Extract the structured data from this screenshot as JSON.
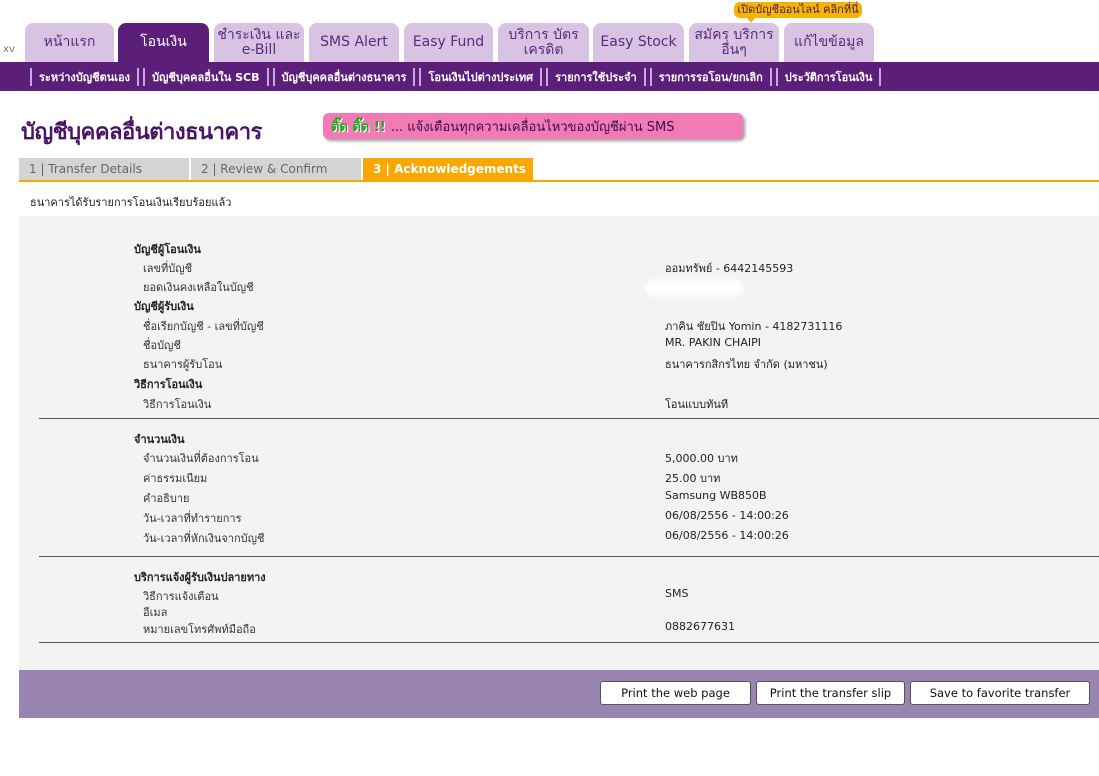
{
  "header": {
    "xv": "xv",
    "promo": "เปิดบัญชีออนไลน์ คลิกที่นี่",
    "tabs": [
      {
        "label": "หน้าแรก"
      },
      {
        "label": "โอนเงิน"
      },
      {
        "label": "ชำระเงิน และ e-Bill"
      },
      {
        "label": "SMS Alert"
      },
      {
        "label": "Easy Fund"
      },
      {
        "label": "บริการ บัตรเครดิต"
      },
      {
        "label": "Easy Stock"
      },
      {
        "label": "สมัคร บริการอื่นๆ"
      },
      {
        "label": "แก้ไขข้อมูล"
      }
    ]
  },
  "subnav": [
    "ระหว่างบัญชีตนเอง",
    "บัญชีบุคคลอื่นใน SCB",
    "บัญชีบุคคลอื่นต่างธนาคาร",
    "โอนเงินไปต่างประเทศ",
    "รายการใช้ประจำ",
    "รายการรอโอน/ยกเลิก",
    "ประวัติการโอนเงิน"
  ],
  "page": {
    "title": "บัญชีบุคคลอื่นต่างธนาคาร",
    "sms_banner_hl": "ติ๊ด ติ๊ด !!",
    "sms_banner": "... แจ้งเตือนทุกความเคลื่อนไหวของบัญชีผ่าน SMS",
    "confirm_msg": "ธนาคารได้รับรายการโอนเงินเรียบร้อยแล้ว"
  },
  "steps": [
    {
      "label": "1 | Transfer Details"
    },
    {
      "label": "2 | Review & Confirm"
    },
    {
      "label": "3 | Acknowledgements"
    }
  ],
  "details": {
    "from_head": "บัญชีผู้โอนเงิน",
    "from_account_lbl": "เลขที่บัญชี",
    "from_account_val": "ออมทรัพย์ - 6442145593",
    "balance_lbl": "ยอดเงินคงเหลือในบัญชี",
    "to_head": "บัญชีผู้รับเงิน",
    "to_alias_lbl": "ชื่อเรียกบัญชี - เลขที่บัญชี",
    "to_alias_val": "ภาคิน ชัยปิน Yomin - 4182731116",
    "to_name_lbl": "ชื่อบัญชี",
    "to_name_val": "MR. PAKIN CHAIPI",
    "to_bank_lbl": "ธนาคารผู้รับโอน",
    "to_bank_val": "ธนาคารกสิกรไทย จำกัด (มหาชน)",
    "method_head": "วิธีการโอนเงิน",
    "method_lbl": "วิธีการโอนเงิน",
    "method_val": "โอนแบบทันที",
    "amount_head": "จำนวนเงิน",
    "amount_lbl": "จำนวนเงินที่ต้องการโอน",
    "amount_val": "5,000.00 บาท",
    "fee_lbl": "ค่าธรรมเนียม",
    "fee_val": "25.00  บาท",
    "desc_lbl": "คำอธิบาย",
    "desc_val": "Samsung WB850B",
    "txn_time_lbl": "วัน-เวลาที่ทำรายการ",
    "txn_time_val": "06/08/2556 - 14:00:26",
    "debit_time_lbl": "วัน-เวลาที่หักเงินจากบัญชี",
    "debit_time_val": "06/08/2556 - 14:00:26",
    "notify_head": "บริการแจ้งผู้รับเงินปลายทาง",
    "notify_method_lbl": "วิธีการแจ้งเตือน",
    "notify_method_val": "SMS",
    "email_lbl": "อีเมล",
    "phone_lbl": "หมายเลขโทรศัพท์มือถือ",
    "phone_val": "0882677631"
  },
  "buttons": {
    "print_page": "Print the web page",
    "print_slip": "Print the transfer slip",
    "save_fav": "Save to favorite transfer"
  }
}
